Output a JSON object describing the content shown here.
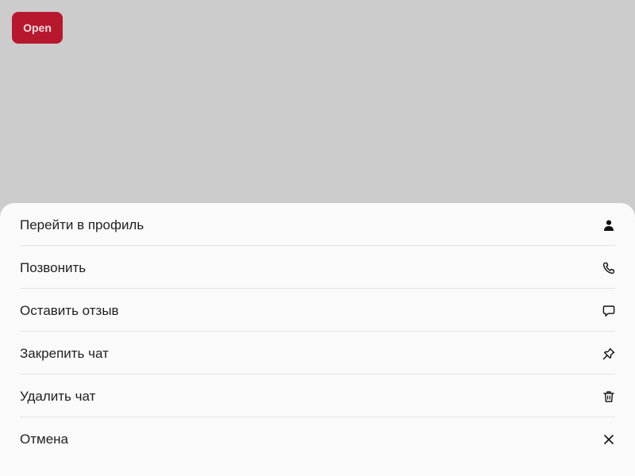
{
  "open_button": {
    "label": "Open"
  },
  "colors": {
    "backdrop": "#cccccc",
    "accent": "#b8182e",
    "sheet_background": "#fafafa",
    "divider": "#e4e4e4",
    "text": "#1f1f1f"
  },
  "action_sheet": {
    "items": [
      {
        "label": "Перейти в профиль",
        "icon": "person-icon"
      },
      {
        "label": "Позвонить",
        "icon": "phone-icon"
      },
      {
        "label": "Оставить отзыв",
        "icon": "chat-bubble-icon"
      },
      {
        "label": "Закрепить чат",
        "icon": "pin-icon"
      },
      {
        "label": "Удалить чат",
        "icon": "trash-icon"
      },
      {
        "label": "Отмена",
        "icon": "close-icon"
      }
    ]
  }
}
